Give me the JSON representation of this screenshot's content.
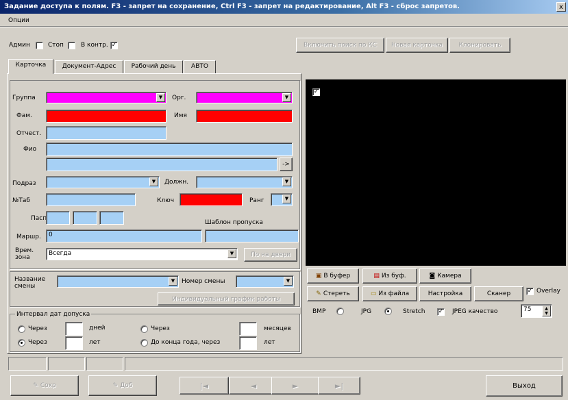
{
  "window": {
    "title": "Задание доступа к полям. F3 - запрет на сохранение, Ctrl F3 - запрет на редактирование, Alt F3 - сброс запретов.",
    "close": "x"
  },
  "menu": {
    "options": "Опции"
  },
  "toolbar": {
    "admin_label": "Админ",
    "admin_checked": false,
    "stop_label": "Стоп",
    "stop_checked": false,
    "control_label": "В контр.",
    "control_checked": true,
    "enable_search_label": "Включить поиск по КС",
    "new_card_label": "Новая карточка",
    "clone_label": "Клонировать"
  },
  "tabs": [
    {
      "label": "Карточка"
    },
    {
      "label": "Документ-Адрес"
    },
    {
      "label": "Рабочий день"
    },
    {
      "label": "АВТО"
    }
  ],
  "card": {
    "group_label": "Группа",
    "org_label": "Орг.",
    "surname_label": "Фам.",
    "name_label": "Имя",
    "patronymic_label": "Отчест.",
    "fio_label": "Фио",
    "fio_arrow": "->",
    "department_label": "Подраз",
    "position_label": "Должн.",
    "tab_number_label": "№Таб",
    "key_label": "Ключ",
    "rank_label": "Ранг",
    "pass_label": "Пасп",
    "pass_template_label": "Шаблон пропуска",
    "route_label": "Маршр.",
    "route_value": "0",
    "time_zone_label": "Врем. зона",
    "time_zone_value": "Всегда",
    "by_door_label": "По на двери",
    "shift_name_label": "Название смены",
    "shift_number_label": "Номер смены",
    "individual_schedule_label": "Индивидуальный график работы",
    "interval": {
      "title": "Интервал дат допуска",
      "after_label": "Через",
      "days_label": "дней",
      "months_label": "месяцев",
      "years_label": "лет",
      "end_of_year_label": "До конца года, через",
      "selected": "after-years"
    }
  },
  "camera": {
    "overlay_checked": true,
    "to_buffer": "В буфер",
    "from_buffer": "Из буф.",
    "camera": "Камера",
    "erase": "Стереть",
    "from_file": "Из файла",
    "settings": "Настройка",
    "scanner": "Сканер",
    "overlay_label": "Overlay",
    "bmp_label": "BMP",
    "jpg_label": "JPG",
    "format_selected": "JPG",
    "stretch_label": "Stretch",
    "stretch_checked": true,
    "jpeg_quality_label": "JPEG качество",
    "jpeg_quality_value": "75"
  },
  "bottom": {
    "save_label": "Сохр",
    "add_label": "Доб",
    "first_label": "|◄",
    "prev_label": "◄",
    "next_label": "►",
    "last_label": "►|",
    "exit_label": "Выход"
  },
  "colors": {
    "magenta": "#ff00ff",
    "red": "#ff0000",
    "light_blue": "#a6d0f5",
    "camera_bg": "#000000"
  }
}
